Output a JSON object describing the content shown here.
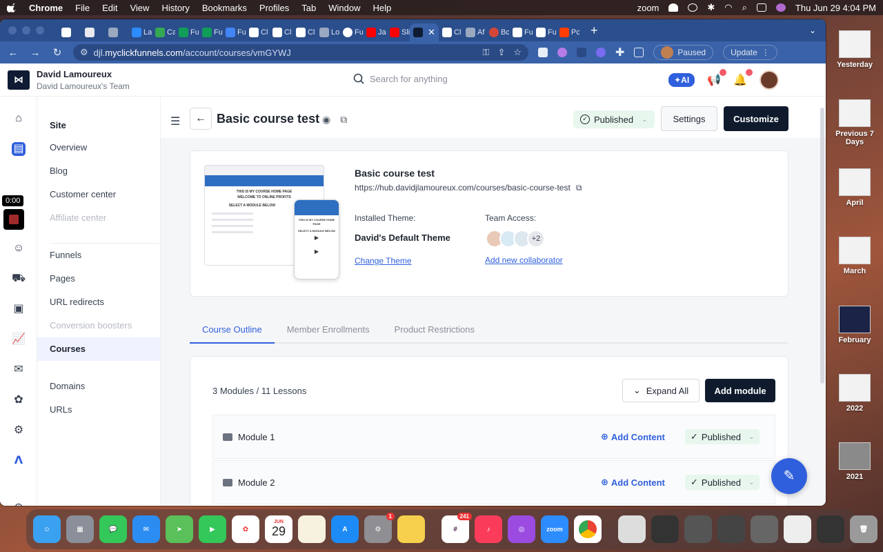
{
  "menubar": {
    "app": "Chrome",
    "items": [
      "File",
      "Edit",
      "View",
      "History",
      "Bookmarks",
      "Profiles",
      "Tab",
      "Window",
      "Help"
    ],
    "right_app": "zoom",
    "datetime": "Thu Jun 29  4:04 PM"
  },
  "browser": {
    "tabs": [
      {
        "label": "",
        "color": "#ffffff"
      },
      {
        "label": "",
        "color": "#e8eaf0"
      },
      {
        "label": "",
        "color": "#9aa8c0"
      },
      {
        "label": "La",
        "color": "#2d8cff"
      },
      {
        "label": "Ca",
        "color": "#34a853"
      },
      {
        "label": "Fu",
        "color": "#0f9d58"
      },
      {
        "label": "Fu",
        "color": "#0f9d58"
      },
      {
        "label": "Fu",
        "color": "#4285f4"
      },
      {
        "label": "Cl",
        "color": "#ffffff"
      },
      {
        "label": "Cl",
        "color": "#ffffff"
      },
      {
        "label": "Cl",
        "color": "#ffffff"
      },
      {
        "label": "Lo",
        "color": "#9aa8c0"
      },
      {
        "label": "Fu",
        "color": "#ffffff"
      },
      {
        "label": "Ja",
        "color": "#ff0000"
      },
      {
        "label": "Sli",
        "color": "#ff0000"
      },
      {
        "label": "",
        "color": "#0f1b33",
        "active": true
      },
      {
        "label": "Cl",
        "color": "#ffffff"
      },
      {
        "label": "Af",
        "color": "#9aa8c0"
      },
      {
        "label": "Bc",
        "color": "#d44638"
      },
      {
        "label": "Fu",
        "color": "#ffffff"
      },
      {
        "label": "Fu",
        "color": "#ffffff"
      },
      {
        "label": "Pc",
        "color": "#ff3d00"
      }
    ],
    "url_prefix": "djl.",
    "url_host": "myclickfunnels.com",
    "url_path": "/account/courses/vmGYWJ",
    "profile_status": "Paused",
    "update_label": "Update"
  },
  "app": {
    "team_name": "David Lamoureux",
    "team_sub": "David Lamoureux's Team",
    "search_placeholder": "Search for anything",
    "ai_label": "AI",
    "timer": "0:00"
  },
  "subnav": {
    "group_title": "Site",
    "items_top": [
      {
        "label": "Overview",
        "muted": false
      },
      {
        "label": "Blog",
        "muted": false
      },
      {
        "label": "Customer center",
        "muted": false
      },
      {
        "label": "Affiliate center",
        "muted": true
      }
    ],
    "items_mid": [
      {
        "label": "Funnels",
        "muted": false
      },
      {
        "label": "Pages",
        "muted": false
      },
      {
        "label": "URL redirects",
        "muted": false
      },
      {
        "label": "Conversion boosters",
        "muted": true
      },
      {
        "label": "Courses",
        "muted": false,
        "active": true
      }
    ],
    "items_bottom": [
      {
        "label": "Domains"
      },
      {
        "label": "URLs"
      }
    ]
  },
  "header": {
    "title": "Basic course test",
    "status": "Published",
    "settings_label": "Settings",
    "customize_label": "Customize"
  },
  "course": {
    "name": "Basic course test",
    "url": "https://hub.davidjlamoureux.com/courses/basic-course-test",
    "installed_theme_label": "Installed Theme:",
    "theme_name": "David's Default Theme",
    "change_theme": "Change Theme",
    "team_access_label": "Team Access:",
    "more_count": "+2",
    "add_collaborator": "Add new collaborator",
    "preview_text_1": "THIS IS MY COURSE HOME PAGE",
    "preview_text_2": "WELCOME TO ONLINE PROFITS",
    "preview_text_3": "SELECT A MODULE BELOW"
  },
  "tabs": [
    {
      "label": "Course Outline",
      "active": true
    },
    {
      "label": "Member Enrollments",
      "active": false
    },
    {
      "label": "Product Restrictions",
      "active": false
    }
  ],
  "outline": {
    "counts": "3 Modules / 11 Lessons",
    "expand_label": "Expand All",
    "add_module_label": "Add module",
    "modules": [
      {
        "name": "Module 1",
        "add_content": "Add Content",
        "status": "Published"
      },
      {
        "name": "Module 2",
        "add_content": "Add Content",
        "status": "Published"
      }
    ]
  },
  "desktop": {
    "folders": [
      "Yesterday",
      "Previous 7 Days",
      "April",
      "March",
      "February",
      "2022",
      "2021"
    ]
  },
  "dock": {
    "calendar_month": "JUN",
    "calendar_day": "29",
    "settings_badge": "1",
    "slack_badge": "241",
    "zoom_label": "zoom"
  }
}
